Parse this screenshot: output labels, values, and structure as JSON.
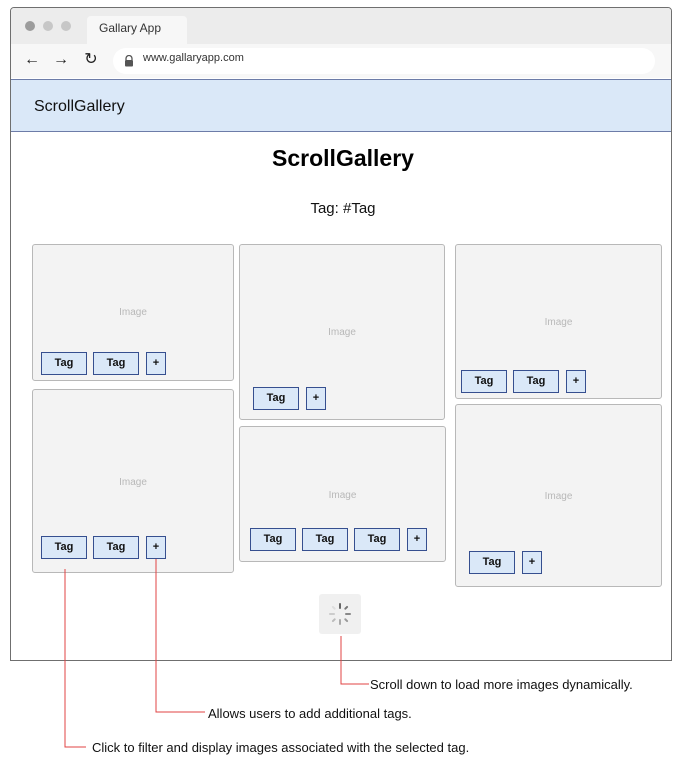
{
  "window": {
    "tab_title": "Gallary App",
    "url": "www.gallaryapp.com"
  },
  "header": {
    "brand": "ScrollGallery"
  },
  "page": {
    "title": "ScrollGallery",
    "filter_label": "Tag: #Tag"
  },
  "gallery": {
    "image_label": "Image",
    "tag_label": "Tag",
    "add_label": "+"
  },
  "spinner": {
    "icon": "loading-spinner-icon"
  },
  "annotations": {
    "scroll": "Scroll down to load more images dynamically.",
    "add": "Allows users to add additional tags.",
    "filter": "Click to filter and display images associated with the selected tag."
  },
  "colors": {
    "accent": "#dae8f8",
    "tag_border": "#364f8f",
    "annotation_line": "#e04343"
  }
}
